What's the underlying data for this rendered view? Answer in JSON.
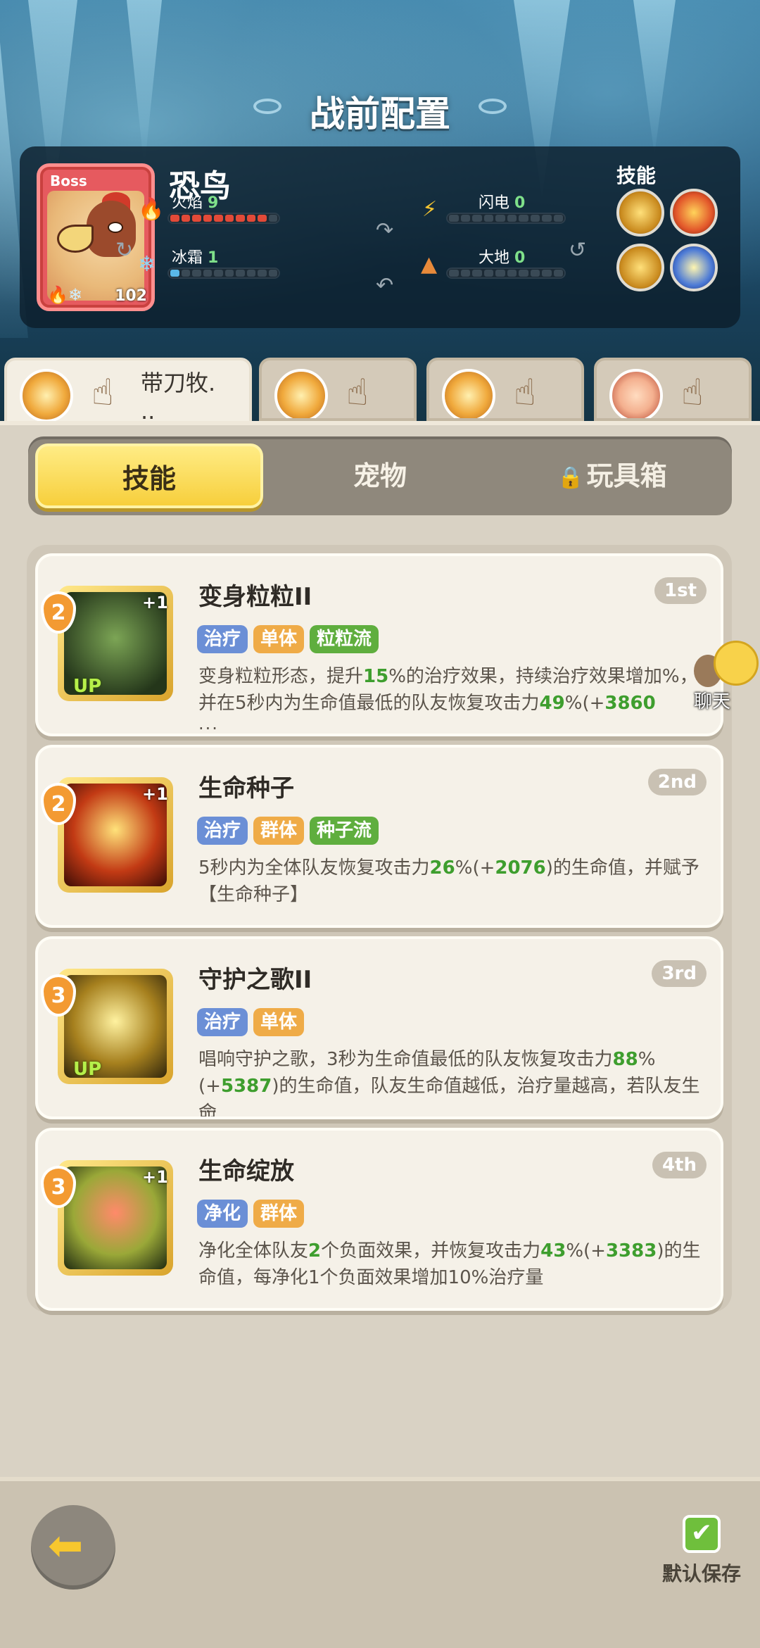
{
  "title": "战前配置",
  "boss": {
    "tag": "Boss",
    "name": "恐鸟",
    "level": "102",
    "stats": [
      {
        "label": "火焰",
        "value": "9"
      },
      {
        "label": "闪电",
        "value": "0"
      },
      {
        "label": "冰霜",
        "value": "1"
      },
      {
        "label": "大地",
        "value": "0"
      }
    ],
    "skills_label": "技能"
  },
  "team_tabs": [
    {
      "name": "带刀牧.\n..",
      "active": true
    },
    {
      "name": "",
      "active": false
    },
    {
      "name": "",
      "active": false
    },
    {
      "name": "",
      "active": false
    }
  ],
  "segments": {
    "skills": "技能",
    "pets": "宠物",
    "toys": "玩具箱"
  },
  "skill_cards": [
    {
      "name": "变身粒粒II",
      "rank": "1st",
      "cost": "2",
      "plus": "+1",
      "up": "UP",
      "tags": [
        "治疗",
        "单体",
        "粒粒流"
      ],
      "desc_parts": [
        "变身粒粒形态，提升",
        "15",
        "%的治疗效果，持续治疗效果增加",
        "%，并在5秒内为生命值最低的队友恢复攻击力",
        "49",
        "%(+",
        "3860",
        ""
      ],
      "ellipsis": "..."
    },
    {
      "name": "生命种子",
      "rank": "2nd",
      "cost": "2",
      "plus": "+1",
      "up": "",
      "tags": [
        "治疗",
        "群体",
        "种子流"
      ],
      "desc_parts": [
        "5秒内为全体队友恢复攻击力",
        "26",
        "%(+",
        "2076",
        ")的生命值，并赋予【生命种子】"
      ],
      "ellipsis": ""
    },
    {
      "name": "守护之歌II",
      "rank": "3rd",
      "cost": "3",
      "plus": "",
      "up": "UP",
      "tags": [
        "治疗",
        "单体"
      ],
      "desc_parts": [
        "唱响守护之歌，3秒为生命值最低的队友恢复攻击力",
        "88",
        "%(+",
        "5387",
        ")的生命值，队友生命值越低，治疗量越高，若队友生命"
      ],
      "ellipsis": "..."
    },
    {
      "name": "生命绽放",
      "rank": "4th",
      "cost": "3",
      "plus": "+1",
      "up": "",
      "tags": [
        "净化",
        "群体"
      ],
      "desc_parts": [
        "净化全体队友",
        "2",
        "个负面效果，并恢复攻击力",
        "43",
        "%(+",
        "3383",
        ")的生命值，每净化1个负面效果增加10%治疗量"
      ],
      "ellipsis": ""
    }
  ],
  "chat": {
    "label": "聊天"
  },
  "bottom": {
    "save_label": "默认保存"
  },
  "colors": {
    "accent_yellow": "#f7cf3c",
    "heal_green": "#3e9e2e",
    "tag_blue": "#6b8fd6",
    "tag_orange": "#efab47",
    "tag_green": "#5fae3e"
  },
  "icons": {
    "back": "back-arrow-icon",
    "save": "checkbox-checked-icon",
    "lock": "lock-icon"
  }
}
